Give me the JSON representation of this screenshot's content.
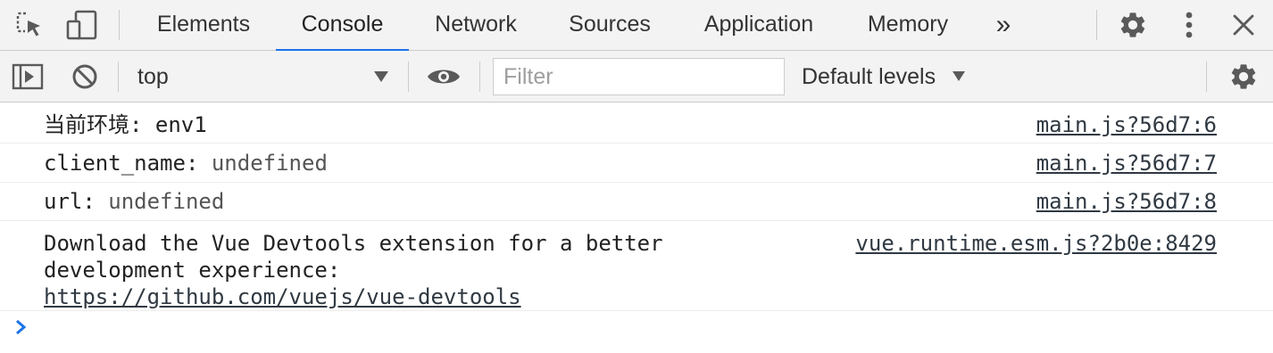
{
  "tabs": [
    {
      "label": "Elements",
      "active": false
    },
    {
      "label": "Console",
      "active": true
    },
    {
      "label": "Network",
      "active": false
    },
    {
      "label": "Sources",
      "active": false
    },
    {
      "label": "Application",
      "active": false
    },
    {
      "label": "Memory",
      "active": false
    }
  ],
  "tab_overflow": "»",
  "icons": {
    "inspect": "inspect-element-icon",
    "device": "device-toolbar-icon",
    "settings": "gear-icon",
    "more": "kebab-menu-icon",
    "close": "close-icon",
    "sidebar": "show-sidebar-icon",
    "clear": "clear-console-icon",
    "live_expression": "eye-icon",
    "console_settings": "gear-icon",
    "prompt": "chevron-right-icon"
  },
  "toolbar": {
    "context": "top",
    "filter_placeholder": "Filter",
    "filter_value": "",
    "levels": "Default levels"
  },
  "messages": [
    {
      "key": "当前环境: ",
      "value": "env1",
      "value_dim": false,
      "source": "main.js?56d7:6"
    },
    {
      "key": "client_name: ",
      "value": "undefined",
      "value_dim": true,
      "source": "main.js?56d7:7"
    },
    {
      "key": "url: ",
      "value": "undefined",
      "value_dim": true,
      "source": "main.js?56d7:8"
    }
  ],
  "vue_message": {
    "line1": "Download the Vue Devtools extension for a better",
    "line2": "development experience:",
    "link": "https://github.com/vuejs/vue-devtools",
    "source": "vue.runtime.esm.js?2b0e:8429"
  },
  "colors": {
    "accent": "#1a73e8",
    "toolbar_bg": "#f3f3f3",
    "icon": "#5a5a5a",
    "prompt": "#1a73e8"
  }
}
